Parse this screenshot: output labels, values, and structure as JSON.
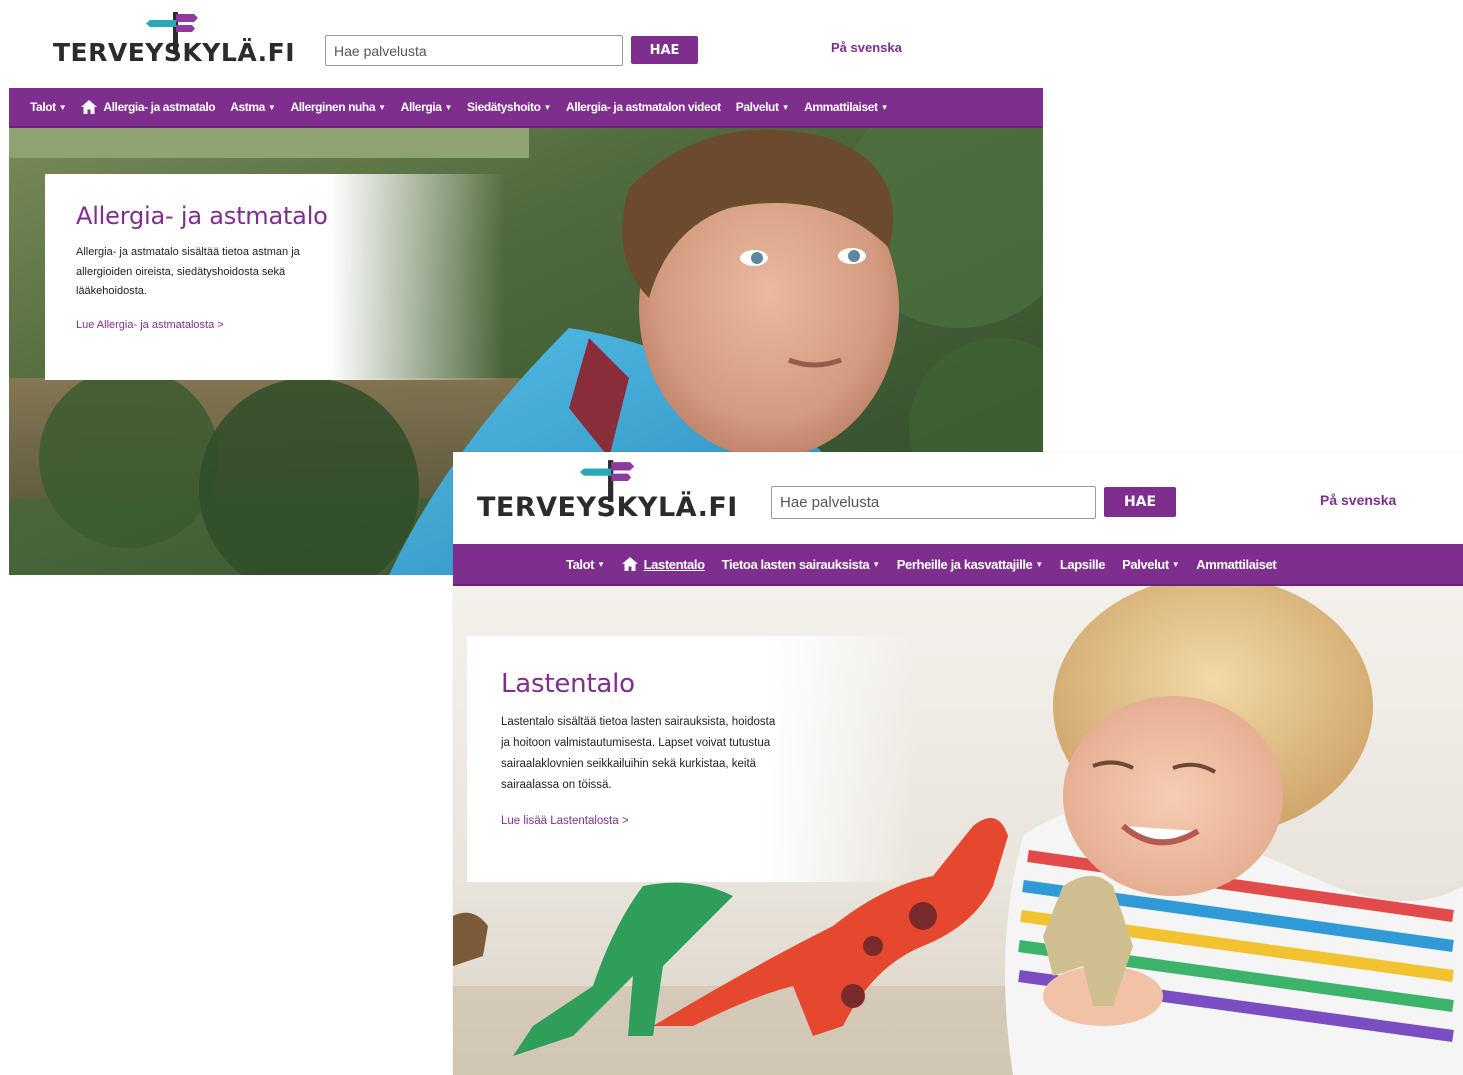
{
  "screens": [
    {
      "id": "allergia",
      "logo": {
        "text": "TERVEYSKYLÄ.FI"
      },
      "search": {
        "placeholder": "Hae palvelusta",
        "button": "HAE"
      },
      "lang_link": "På svenska",
      "nav": [
        {
          "label": "Talot",
          "dropdown": true
        },
        {
          "label": "Allergia- ja astmatalo",
          "home": true
        },
        {
          "label": "Astma",
          "dropdown": true
        },
        {
          "label": "Allerginen nuha",
          "dropdown": true
        },
        {
          "label": "Allergia",
          "dropdown": true
        },
        {
          "label": "Siedätyshoito",
          "dropdown": true
        },
        {
          "label": "Allergia- ja astmatalon videot"
        },
        {
          "label": "Palvelut",
          "dropdown": true
        },
        {
          "label": "Ammattilaiset",
          "dropdown": true
        }
      ],
      "hero": {
        "title": "Allergia- ja astmatalo",
        "text": "Allergia- ja astmatalo sisältää tietoa astman ja allergioiden oireista, siedätyshoidosta sekä lääkehoidosta.",
        "link": "Lue Allergia- ja astmatalosta >"
      }
    },
    {
      "id": "lastentalo",
      "logo": {
        "text": "TERVEYSKYLÄ.FI"
      },
      "search": {
        "placeholder": "Hae palvelusta",
        "button": "HAE"
      },
      "lang_link": "På svenska",
      "nav": [
        {
          "label": "Talot",
          "dropdown": true
        },
        {
          "label": "Lastentalo",
          "home": true,
          "underlined": true
        },
        {
          "label": "Tietoa lasten sairauksista",
          "dropdown": true
        },
        {
          "label": "Perheille ja kasvattajille",
          "dropdown": true
        },
        {
          "label": "Lapsille"
        },
        {
          "label": "Palvelut",
          "dropdown": true
        },
        {
          "label": "Ammattilaiset"
        }
      ],
      "hero": {
        "title": "Lastentalo",
        "text": "Lastentalo sisältää tietoa lasten sairauksista, hoidosta ja hoitoon valmistautumisesta. Lapset voivat tutustua sairaalaklovnien seikkailuihin sekä kurkistaa, keitä sairaalassa on töissä.",
        "link": "Lue lisää Lastentalosta >"
      }
    }
  ],
  "colors": {
    "brand_purple": "#7e2f8e",
    "logo_purple": "#8e3a9e",
    "logo_teal": "#2aa8b8",
    "logo_dark": "#2b2b2b"
  }
}
